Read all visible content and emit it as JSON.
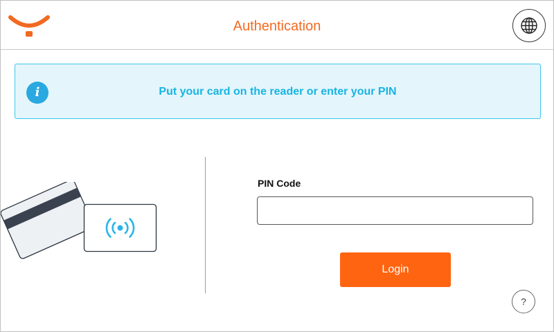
{
  "header": {
    "title": "Authentication",
    "logo_icon": "brand-smile-logo",
    "language_icon": "globe-icon",
    "brand_color": "#f26a21"
  },
  "info_banner": {
    "icon": "info-icon",
    "icon_glyph": "i",
    "message": "Put your card on the reader or enter your PIN",
    "accent_color": "#18b4e4"
  },
  "card_reader": {
    "card_icon": "magnetic-card-icon",
    "reader_icon": "contactless-reader-icon"
  },
  "pin_form": {
    "label": "PIN Code",
    "value": "",
    "placeholder": ""
  },
  "login_button": {
    "label": "Login",
    "color": "#ff6410"
  },
  "help_button": {
    "label": "?"
  }
}
